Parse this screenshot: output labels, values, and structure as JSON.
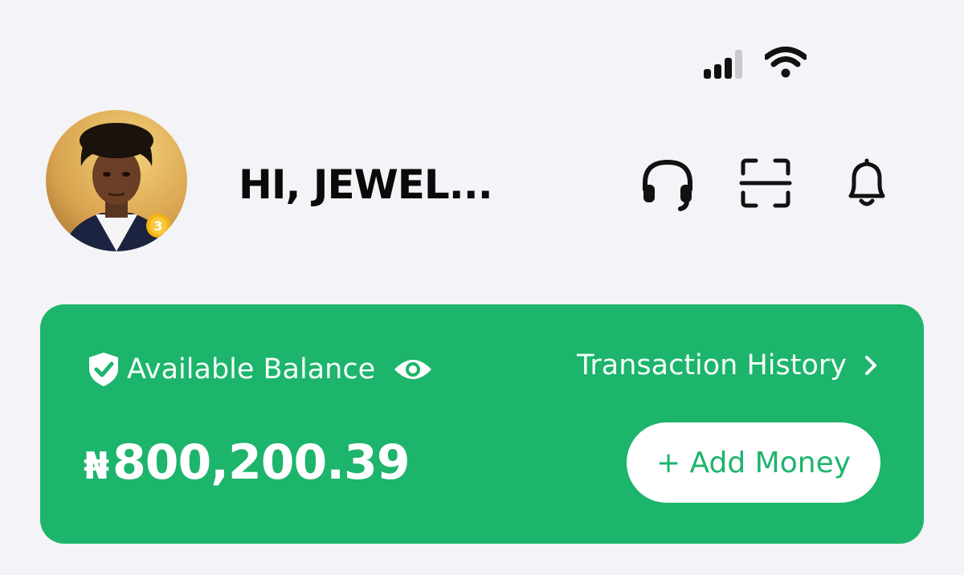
{
  "status_bar": {
    "signal_icon": "cellular-signal-icon",
    "wifi_icon": "wifi-icon"
  },
  "header": {
    "greeting": "HI, JEWEL...",
    "avatar_badge": "3",
    "icons": [
      "headset-support-icon",
      "scan-icon",
      "bell-icon"
    ]
  },
  "balance_card": {
    "label": "Available Balance",
    "shield_icon": "shield-check-icon",
    "eye_icon": "eye-icon",
    "history_label": "Transaction History",
    "history_chevron": "›",
    "currency_symbol": "₦",
    "amount": "800,200.39",
    "add_money_label": "+ Add Money",
    "accent_color": "#1db46c"
  }
}
